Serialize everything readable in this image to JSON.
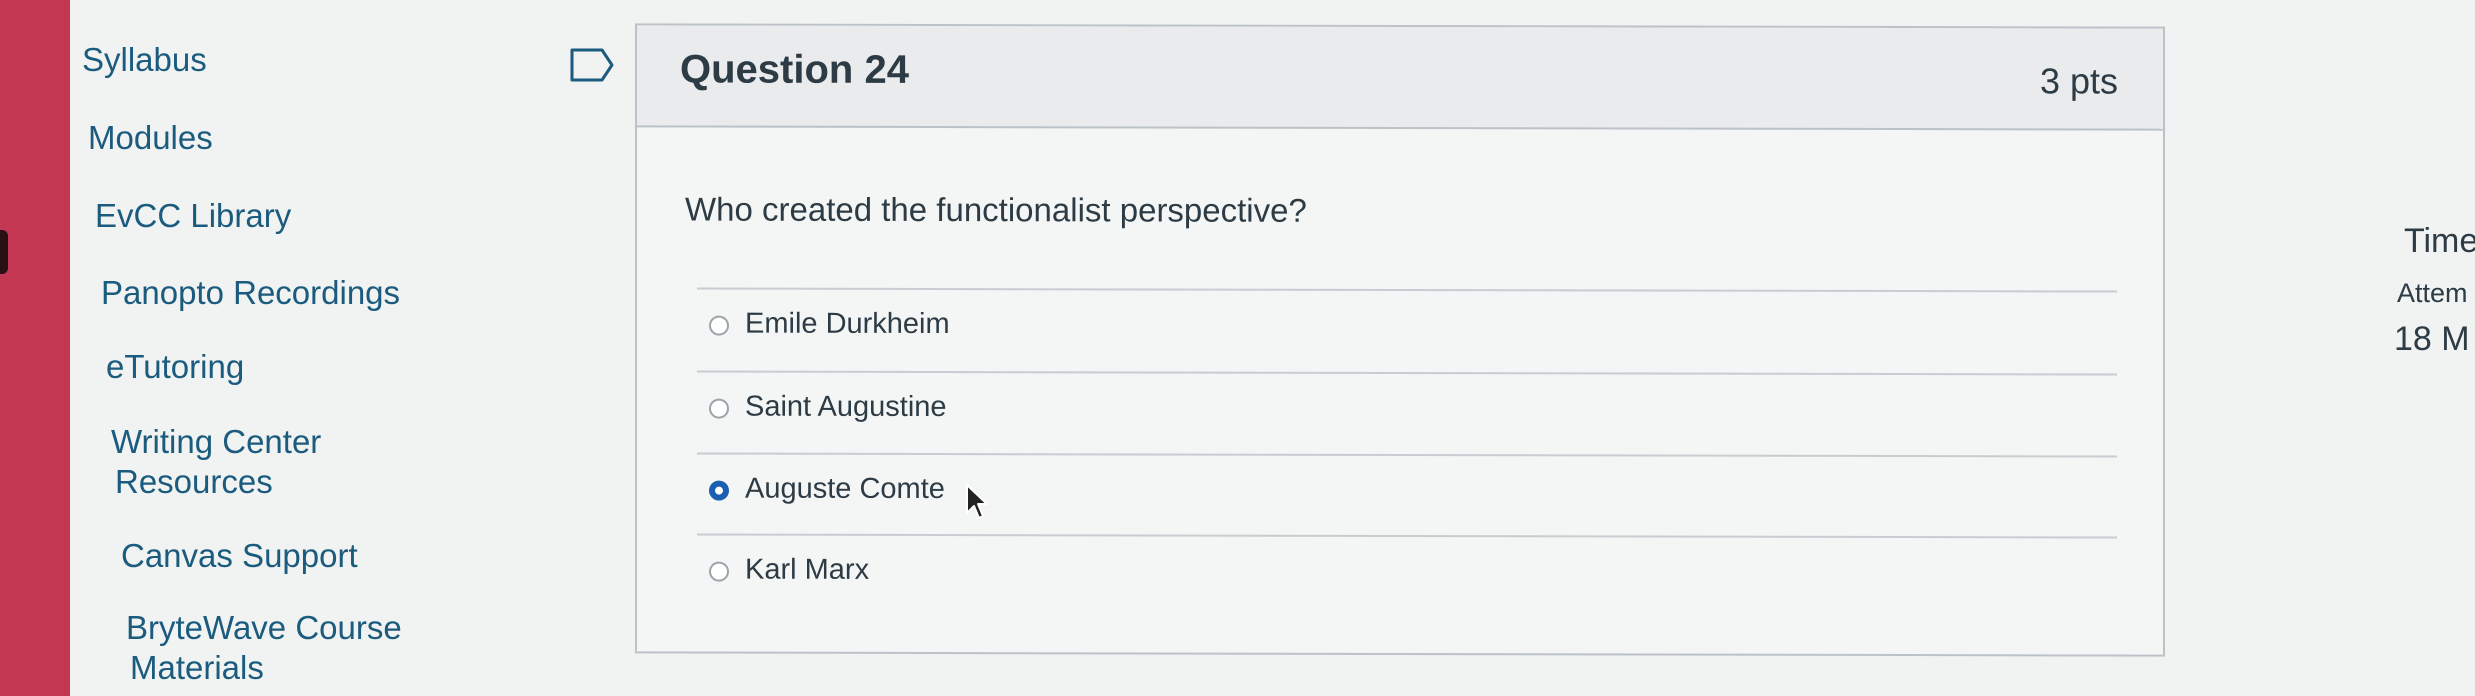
{
  "sidebar": {
    "items": [
      {
        "label": "Syllabus"
      },
      {
        "label": "Modules"
      },
      {
        "label": "EvCC Library"
      },
      {
        "label": "Panopto Recordings"
      },
      {
        "label": "eTutoring"
      },
      {
        "label_line1": "Writing Center",
        "label_line2": "Resources"
      },
      {
        "label": "Canvas Support"
      },
      {
        "label_line1": "BryteWave Course",
        "label_line2": "Materials"
      }
    ]
  },
  "question": {
    "title": "Question 24",
    "points": "3 pts",
    "text": "Who created the functionalist perspective?",
    "answers": [
      {
        "label": "Emile Durkheim",
        "selected": false
      },
      {
        "label": "Saint Augustine",
        "selected": false
      },
      {
        "label": "Auguste Comte",
        "selected": true
      },
      {
        "label": "Karl Marx",
        "selected": false
      }
    ]
  },
  "right_panel": {
    "time_label": "Time",
    "attempt_label": "Attem",
    "minutes": "18 M"
  },
  "icons": {
    "flag": "flag-icon",
    "cursor": "mouse-pointer-icon"
  },
  "colors": {
    "brand_red": "#c43752",
    "link": "#1a5b7e",
    "radio_selected": "#1b5fb0"
  }
}
